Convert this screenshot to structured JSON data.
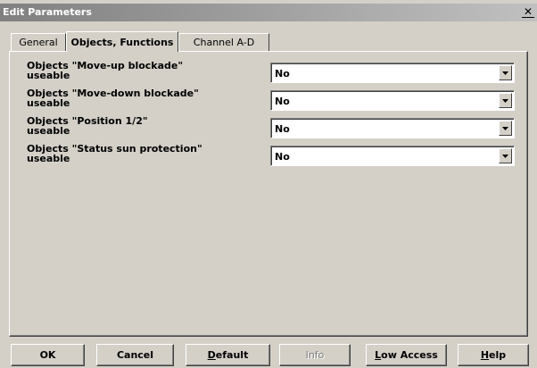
{
  "window": {
    "title": "Edit Parameters",
    "close_glyph": "✕"
  },
  "tabs": [
    {
      "label": "General",
      "active": false
    },
    {
      "label": "Objects, Functions",
      "active": true
    },
    {
      "label": "Channel A-D",
      "active": false
    }
  ],
  "params": [
    {
      "label_line1": "Objects \"Move-up blockade\"",
      "label_line2": "useable",
      "value": "No"
    },
    {
      "label_line1": "Objects \"Move-down blockade\"",
      "label_line2": "useable",
      "value": "No"
    },
    {
      "label_line1": "Objects \"Position 1/2\"",
      "label_line2": "useable",
      "value": "No"
    },
    {
      "label_line1": "Objects \"Status sun protection\"",
      "label_line2": "useable",
      "value": "No"
    }
  ],
  "buttons": {
    "ok": "OK",
    "cancel": "Cancel",
    "default_first": "D",
    "default_rest": "efault",
    "info": "Info",
    "low_access_first": "L",
    "low_access_rest": "ow Access",
    "help_first": "H",
    "help_rest": "elp"
  },
  "icons": {
    "dropdown": "chevron-down-icon",
    "close": "close-icon"
  }
}
